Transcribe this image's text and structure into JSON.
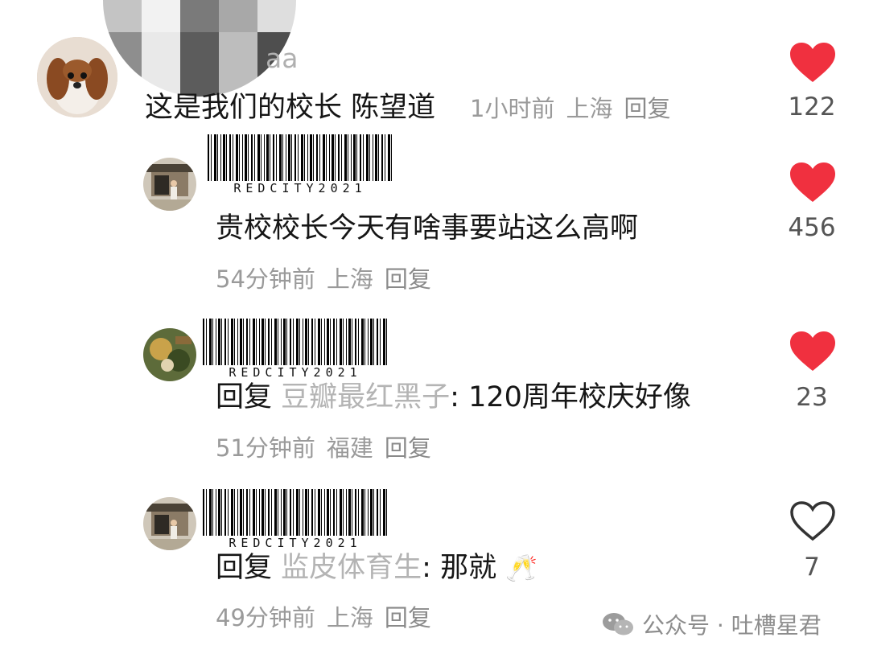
{
  "top_comment": {
    "username_fragment": "aa",
    "text": "这是我们的校长 陈望道",
    "time": "1小时前",
    "location": "上海",
    "reply_label": "回复",
    "likes": "122",
    "liked": true
  },
  "replies": [
    {
      "barcode_text": "REDCITY2021",
      "text": "贵校校长今天有啥事要站这么高啊",
      "time": "54分钟前",
      "location": "上海",
      "reply_label": "回复",
      "likes": "456",
      "liked": true
    },
    {
      "barcode_text": "REDCITY2021",
      "reply_prefix": "回复",
      "quoted_user": "豆瓣最红黑子",
      "text": ": 120周年校庆好像",
      "time": "51分钟前",
      "location": "福建",
      "reply_label": "回复",
      "likes": "23",
      "liked": true
    },
    {
      "barcode_text": "REDCITY2021",
      "reply_prefix": "回复",
      "quoted_user": "监皮体育生",
      "text": ": 那就",
      "emoji": "🥂",
      "time": "49分钟前",
      "location": "上海",
      "reply_label": "回复",
      "likes": "7",
      "liked": false
    }
  ],
  "watermark": {
    "text": "公众号 · 吐槽星君"
  },
  "colors": {
    "heart_liked": "#f0303f",
    "heart_outline": "#333333",
    "meta_gray": "#9a9a9a"
  }
}
